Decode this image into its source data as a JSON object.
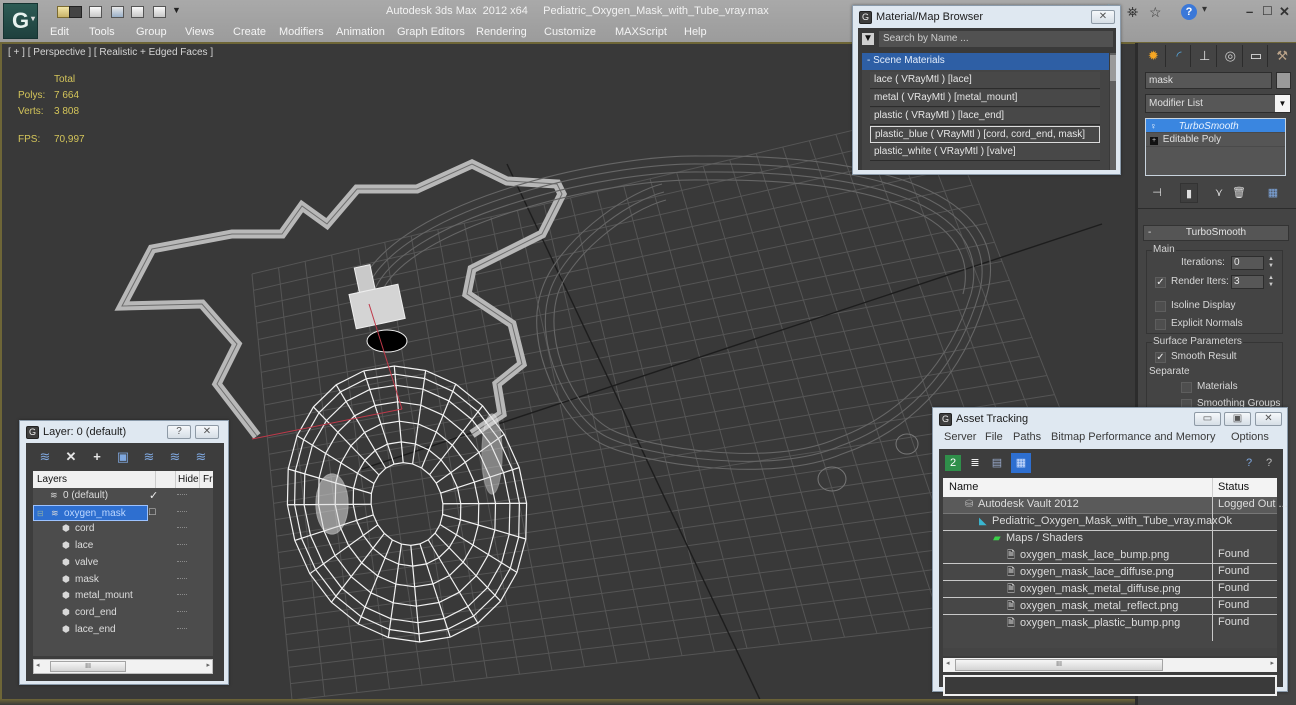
{
  "app": {
    "title": "Autodesk 3ds Max  2012 x64     Pediatric_Oxygen_Mask_with_Tube_vray.max",
    "logo_glyph": "G",
    "menu": [
      "Edit",
      "Tools",
      "Group",
      "Views",
      "Create",
      "Modifiers",
      "Animation",
      "Graph Editors",
      "Rendering",
      "Customize",
      "MAXScript",
      "Help"
    ],
    "quick_access_icons": [
      "open-icon",
      "save-icon",
      "undo-icon",
      "hold-icon",
      "redo-icon",
      "fetch-icon",
      "dropdown-icon"
    ],
    "right_icons": [
      "key-icon",
      "satellite-icon",
      "star-icon",
      "help-icon"
    ],
    "window_controls": [
      "minimize",
      "maximize",
      "close"
    ]
  },
  "viewport": {
    "label": "[ + ] [ Perspective ] [ Realistic + Edged Faces ]",
    "stats": {
      "header": "Total",
      "polys_label": "Polys:",
      "polys_value": "7 664",
      "verts_label": "Verts:",
      "verts_value": "3 808",
      "fps_label": "FPS:",
      "fps_value": "70,997"
    }
  },
  "material_browser": {
    "title": "Material/Map Browser",
    "search_placeholder": "Search by Name ...",
    "section": "-  Scene Materials",
    "items": [
      "lace  ( VRayMtl )  [lace]",
      "metal  ( VRayMtl )  [metal_mount]",
      "plastic  ( VRayMtl )  [lace_end]",
      "plastic_blue  ( VRayMtl )  [cord, cord_end, mask]",
      "plastic_white  ( VRayMtl )  [valve]"
    ],
    "focused_index": 3
  },
  "command_panel": {
    "tabs": [
      "create-tab",
      "modify-tab",
      "hierarchy-tab",
      "motion-tab",
      "display-tab",
      "utilities-tab"
    ],
    "object_name": "mask",
    "modifier_list_label": "Modifier List",
    "stack": [
      {
        "label": "TurboSmooth",
        "selected": true
      },
      {
        "label": "Editable Poly",
        "selected": false
      }
    ],
    "rollout_title": "TurboSmooth",
    "main_group": "Main",
    "iterations_label": "Iterations:",
    "iterations_value": "0",
    "render_iters_label": "Render Iters:",
    "render_iters_value": "3",
    "render_iters_checked": true,
    "isoline_label": "Isoline Display",
    "isoline_checked": false,
    "explicit_normals_label": "Explicit Normals",
    "explicit_normals_checked": false,
    "surface_group": "Surface Parameters",
    "smooth_result_label": "Smooth Result",
    "smooth_result_checked": true,
    "separate_label": "Separate",
    "materials_label": "Materials",
    "smoothing_groups_label": "Smoothing Groups"
  },
  "layer_window": {
    "title": "Layer: 0 (default)",
    "help_btn": "?",
    "close_btn": "✕",
    "columns": {
      "layers": "Layers",
      "hide": "Hide",
      "freeze": "Fr"
    },
    "rows": [
      {
        "name": "0 (default)",
        "type": "layer",
        "indent": 1,
        "check": "✓",
        "selected": false
      },
      {
        "name": "oxygen_mask",
        "type": "layer",
        "indent": 1,
        "check": "□",
        "selected": true
      },
      {
        "name": "cord",
        "type": "object",
        "indent": 2
      },
      {
        "name": "lace",
        "type": "object",
        "indent": 2
      },
      {
        "name": "valve",
        "type": "object",
        "indent": 2
      },
      {
        "name": "mask",
        "type": "object",
        "indent": 2
      },
      {
        "name": "metal_mount",
        "type": "object",
        "indent": 2
      },
      {
        "name": "cord_end",
        "type": "object",
        "indent": 2
      },
      {
        "name": "lace_end",
        "type": "object",
        "indent": 2
      }
    ],
    "scroll_thumb_glyph": "III"
  },
  "asset_tracking": {
    "title": "Asset Tracking",
    "menu": [
      "Server",
      "File",
      "Paths",
      "Bitmap Performance and Memory",
      "Options"
    ],
    "columns": {
      "name": "Name",
      "status": "Status"
    },
    "rows": [
      {
        "name": "Autodesk Vault 2012",
        "status": "Logged Out ...",
        "indent": 1,
        "icon": "vault-icon"
      },
      {
        "name": "Pediatric_Oxygen_Mask_with_Tube_vray.max",
        "status": "Ok",
        "indent": 2,
        "icon": "max-file-icon"
      },
      {
        "name": "Maps / Shaders",
        "status": "",
        "indent": 3,
        "icon": "maps-icon"
      },
      {
        "name": "oxygen_mask_lace_bump.png",
        "status": "Found",
        "indent": 4,
        "icon": "image-file-icon"
      },
      {
        "name": "oxygen_mask_lace_diffuse.png",
        "status": "Found",
        "indent": 4,
        "icon": "image-file-icon"
      },
      {
        "name": "oxygen_mask_metal_diffuse.png",
        "status": "Found",
        "indent": 4,
        "icon": "image-file-icon"
      },
      {
        "name": "oxygen_mask_metal_reflect.png",
        "status": "Found",
        "indent": 4,
        "icon": "image-file-icon"
      },
      {
        "name": "oxygen_mask_plastic_bump.png",
        "status": "Found",
        "indent": 4,
        "icon": "image-file-icon"
      }
    ],
    "scroll_thumb_glyph": "III"
  }
}
